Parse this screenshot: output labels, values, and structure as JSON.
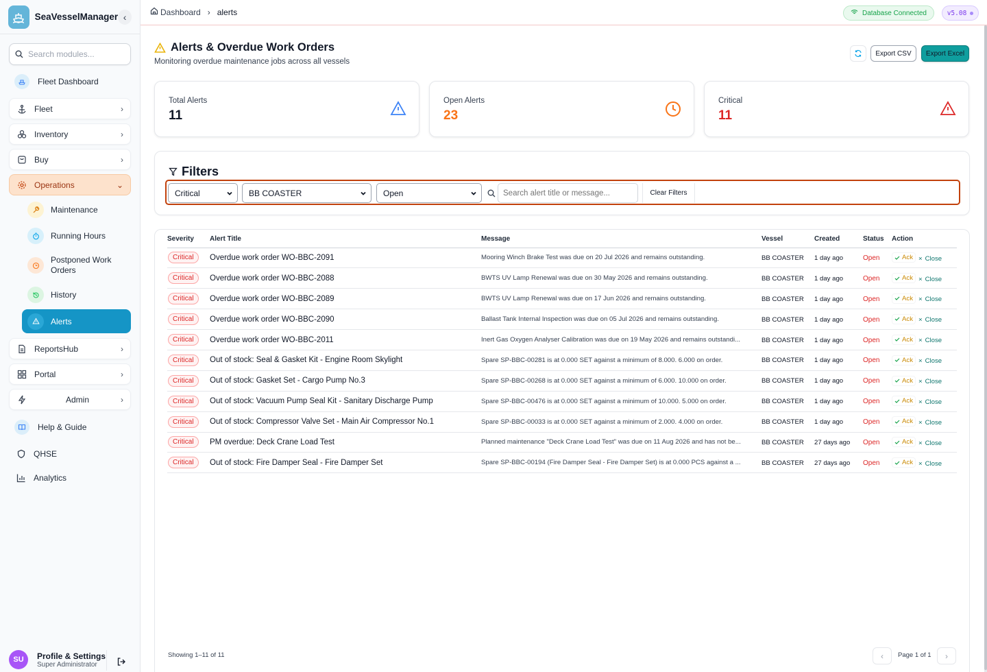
{
  "app": {
    "name": "SeaVesselManager",
    "collapse_icon": "chevron-left-icon"
  },
  "sidebar": {
    "search_placeholder": "Search modules...",
    "items": [
      {
        "label": "Fleet Dashboard",
        "icon": "ship-icon"
      },
      {
        "label": "Fleet",
        "icon": "anchor-icon"
      },
      {
        "label": "Inventory",
        "icon": "boxes-icon"
      },
      {
        "label": "Buy",
        "icon": "shopping-bag-icon"
      },
      {
        "label": "Operations",
        "icon": "gear-icon"
      },
      {
        "label": "ReportsHub",
        "icon": "document-icon"
      },
      {
        "label": "Portal",
        "icon": "grid-icon"
      },
      {
        "label": "Admin",
        "icon": "lightning-icon"
      },
      {
        "label": "Help & Guide",
        "icon": "book-icon"
      },
      {
        "label": "QHSE",
        "icon": "shield-icon"
      },
      {
        "label": "Analytics",
        "icon": "bar-chart-icon"
      }
    ],
    "sub_items": [
      {
        "label": "Maintenance",
        "icon": "wrench-icon"
      },
      {
        "label": "Running Hours",
        "icon": "stopwatch-icon"
      },
      {
        "label": "Postponed Work Orders",
        "icon": "clock-icon"
      },
      {
        "label": "History",
        "icon": "history-icon"
      },
      {
        "label": "Alerts",
        "icon": "warning-icon"
      }
    ],
    "profile": {
      "initials": "SU",
      "name": "Profile & Settings",
      "role": "Super Administrator"
    }
  },
  "topbar": {
    "breadcrumb": [
      "Dashboard",
      "alerts"
    ],
    "db_status": "Database Connected",
    "version": "v5.08"
  },
  "header": {
    "title": "Alerts & Overdue Work Orders",
    "subtitle": "Monitoring overdue maintenance jobs across all vessels",
    "export_csv": "Export CSV",
    "export_excel": "Export Excel"
  },
  "stats": [
    {
      "label": "Total Alerts",
      "value": "11",
      "color": "#111827",
      "icon": "warning-icon"
    },
    {
      "label": "Open Alerts",
      "value": "23",
      "color": "#f97316",
      "icon": "clock-icon"
    },
    {
      "label": "Critical",
      "value": "11",
      "color": "#dc2626",
      "icon": "warning-icon"
    }
  ],
  "filters": {
    "title": "Filters",
    "severity": "Critical",
    "vessel": "BB COASTER",
    "status": "Open",
    "search_placeholder": "Search alert title or message...",
    "clear": "Clear Filters"
  },
  "table": {
    "columns": [
      "Severity",
      "Alert Title",
      "Message",
      "Vessel",
      "Created",
      "Status",
      "Action"
    ],
    "ack_label": "Ack",
    "close_label": "Close",
    "rows": [
      {
        "severity": "Critical",
        "title": "Overdue work order WO-BBC-2091",
        "message": "Mooring Winch Brake Test was due on 20 Jul 2026 and remains outstanding.",
        "vessel": "BB COASTER",
        "created": "1 day ago",
        "status": "Open"
      },
      {
        "severity": "Critical",
        "title": "Overdue work order WO-BBC-2088",
        "message": "BWTS UV Lamp Renewal was due on 30 May 2026 and remains outstanding.",
        "vessel": "BB COASTER",
        "created": "1 day ago",
        "status": "Open"
      },
      {
        "severity": "Critical",
        "title": "Overdue work order WO-BBC-2089",
        "message": "BWTS UV Lamp Renewal was due on 17 Jun 2026 and remains outstanding.",
        "vessel": "BB COASTER",
        "created": "1 day ago",
        "status": "Open"
      },
      {
        "severity": "Critical",
        "title": "Overdue work order WO-BBC-2090",
        "message": "Ballast Tank Internal Inspection was due on 05 Jul 2026 and remains outstanding.",
        "vessel": "BB COASTER",
        "created": "1 day ago",
        "status": "Open"
      },
      {
        "severity": "Critical",
        "title": "Overdue work order WO-BBC-2011",
        "message": "Inert Gas Oxygen Analyser Calibration was due on 19 May 2026 and remains outstandi...",
        "vessel": "BB COASTER",
        "created": "1 day ago",
        "status": "Open"
      },
      {
        "severity": "Critical",
        "title": "Out of stock: Seal & Gasket Kit - Engine Room Skylight",
        "message": "Spare SP-BBC-00281 is at 0.000 SET against a minimum of 8.000. 6.000 on order.",
        "vessel": "BB COASTER",
        "created": "1 day ago",
        "status": "Open"
      },
      {
        "severity": "Critical",
        "title": "Out of stock: Gasket Set - Cargo Pump No.3",
        "message": "Spare SP-BBC-00268 is at 0.000 SET against a minimum of 6.000. 10.000 on order.",
        "vessel": "BB COASTER",
        "created": "1 day ago",
        "status": "Open"
      },
      {
        "severity": "Critical",
        "title": "Out of stock: Vacuum Pump Seal Kit - Sanitary Discharge Pump",
        "message": "Spare SP-BBC-00476 is at 0.000 SET against a minimum of 10.000. 5.000 on order.",
        "vessel": "BB COASTER",
        "created": "1 day ago",
        "status": "Open"
      },
      {
        "severity": "Critical",
        "title": "Out of stock: Compressor Valve Set - Main Air Compressor No.1",
        "message": "Spare SP-BBC-00033 is at 0.000 SET against a minimum of 2.000. 4.000 on order.",
        "vessel": "BB COASTER",
        "created": "1 day ago",
        "status": "Open"
      },
      {
        "severity": "Critical",
        "title": "PM overdue: Deck Crane Load Test",
        "message": "Planned maintenance \"Deck Crane Load Test\" was due on 11 Aug 2026 and has not be...",
        "vessel": "BB COASTER",
        "created": "27 days ago",
        "status": "Open"
      },
      {
        "severity": "Critical",
        "title": "Out of stock: Fire Damper Seal - Fire Damper Set",
        "message": "Spare SP-BBC-00194 (Fire Damper Seal - Fire Damper Set) is at 0.000 PCS against a ...",
        "vessel": "BB COASTER",
        "created": "27 days ago",
        "status": "Open"
      }
    ],
    "footer": "Showing 1–11 of 11",
    "page": "Page 1 of 1"
  }
}
